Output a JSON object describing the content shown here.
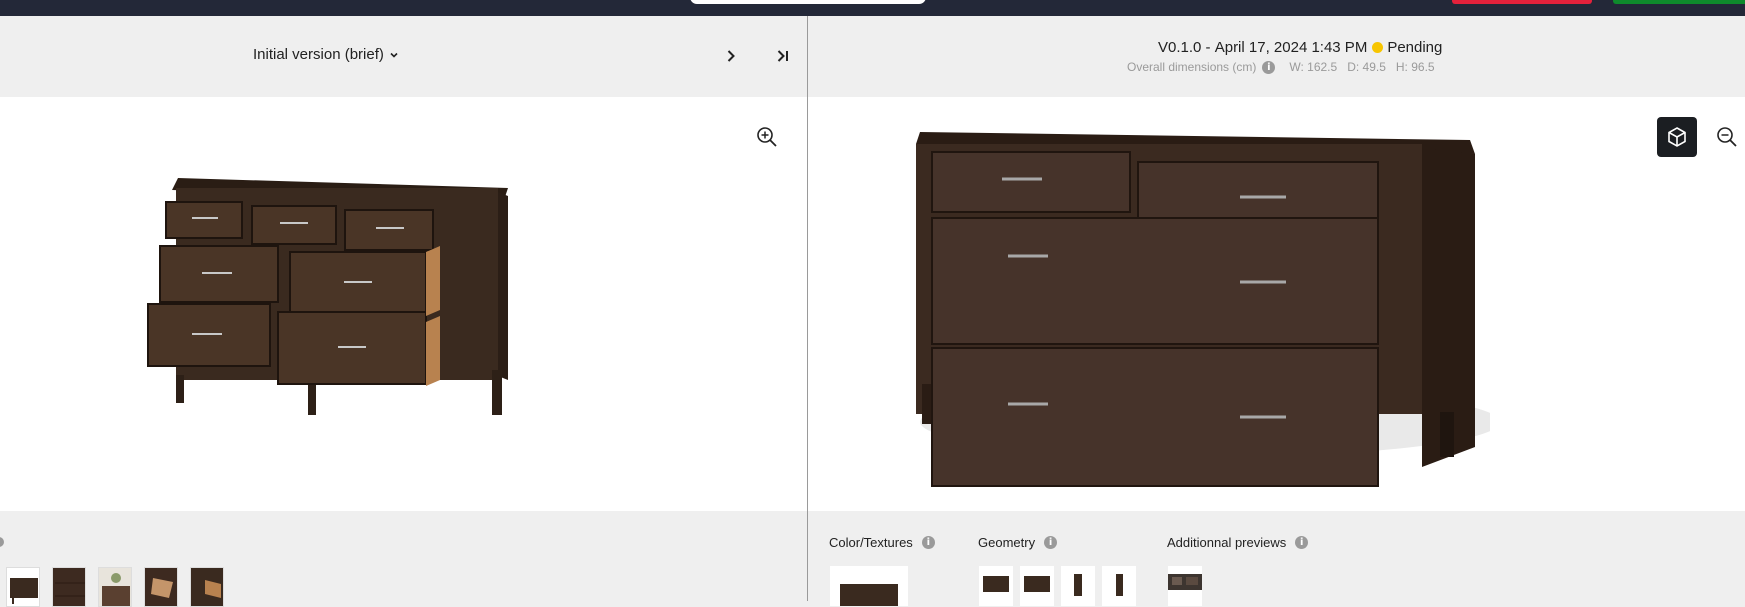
{
  "header": {
    "version_selector": "Initial version (brief)"
  },
  "left_panel": {
    "next_icon": "chevron-right-icon",
    "last_icon": "skip-to-last-icon",
    "zoom_icon": "zoom-in-icon",
    "thumbnails": [
      "dresser-front",
      "dresser-closed",
      "dresser-styled",
      "drawer-interior",
      "drawer-detail"
    ]
  },
  "right_panel": {
    "version": "V0.1.0",
    "separator": "-",
    "date": "April 17, 2024 1:43 PM",
    "status": "Pending",
    "status_color": "#f7c500",
    "dimensions": {
      "label": "Overall dimensions (cm)",
      "width": "W: 162.5",
      "depth": "D: 49.5",
      "height": "H: 96.5"
    },
    "sections": {
      "color_textures": "Color/Textures",
      "geometry": "Geometry",
      "additional_previews": "Additionnal previews"
    },
    "cube_icon": "3d-cube-icon",
    "zoom_icon": "zoom-out-icon"
  },
  "colors": {
    "topbar": "#232838",
    "wood": "#3d2a20",
    "accent_red": "#e3213b",
    "accent_green": "#0e8a2c"
  }
}
